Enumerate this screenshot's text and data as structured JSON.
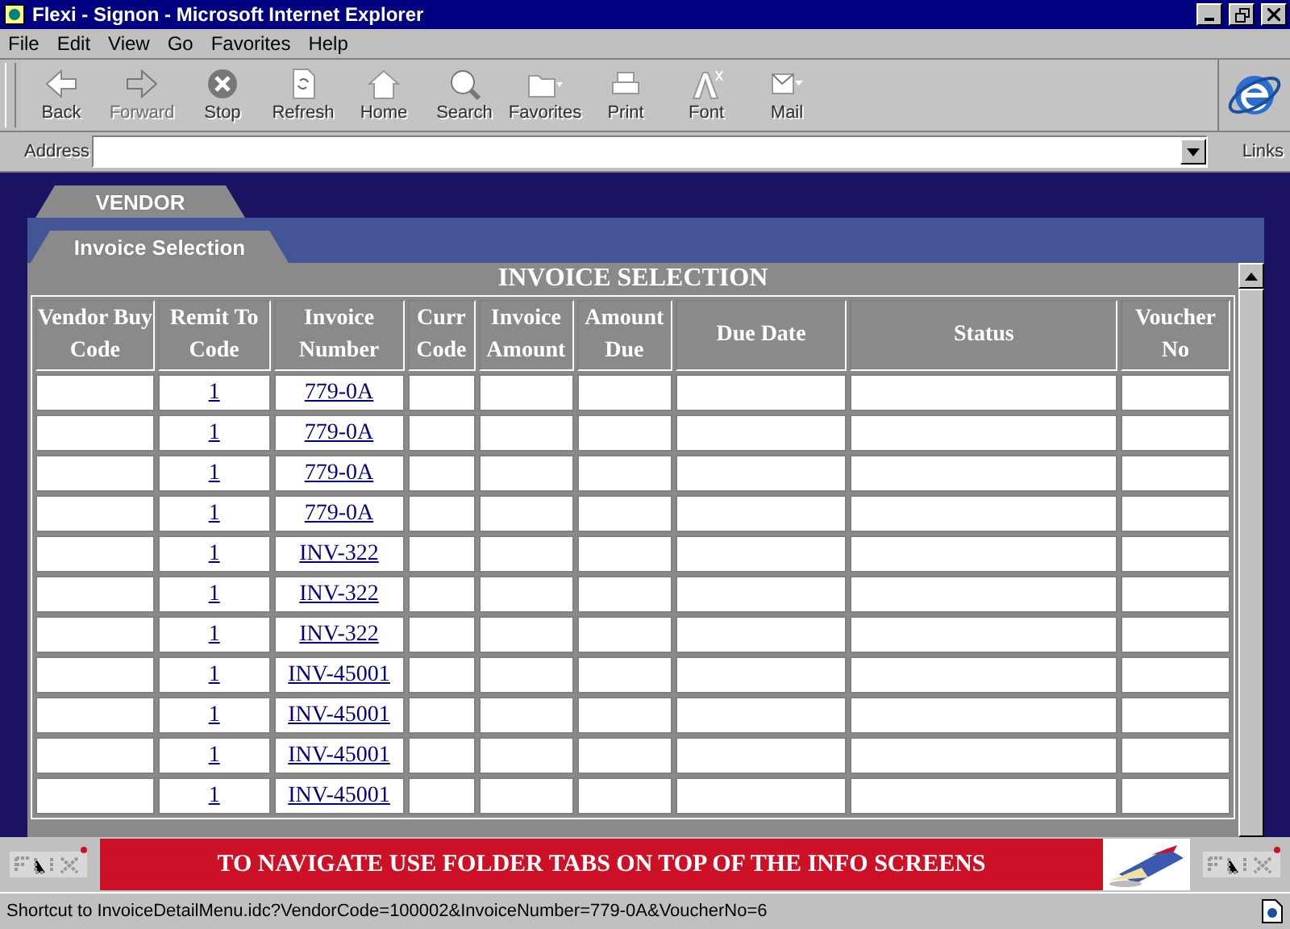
{
  "window": {
    "title": "Flexi - Signon - Microsoft Internet Explorer"
  },
  "menu": [
    "File",
    "Edit",
    "View",
    "Go",
    "Favorites",
    "Help"
  ],
  "toolbar": [
    {
      "label": "Back",
      "kind": "back",
      "disabled": false
    },
    {
      "label": "Forward",
      "kind": "forward",
      "disabled": true
    },
    {
      "label": "Stop",
      "kind": "stop",
      "disabled": false
    },
    {
      "label": "Refresh",
      "kind": "refresh",
      "disabled": false
    },
    {
      "label": "Home",
      "kind": "home",
      "disabled": false
    },
    {
      "label": "Search",
      "kind": "search",
      "disabled": false
    },
    {
      "label": "Favorites",
      "kind": "favorites",
      "disabled": false
    },
    {
      "label": "Print",
      "kind": "print",
      "disabled": false
    },
    {
      "label": "Font",
      "kind": "font",
      "disabled": false
    },
    {
      "label": "Mail",
      "kind": "mail",
      "disabled": false
    }
  ],
  "address": {
    "label": "Address"
  },
  "links": "Links",
  "tabs": [
    {
      "label": "VENDOR"
    },
    {
      "label": "Invoice Selection"
    }
  ],
  "table": {
    "title": "INVOICE SELECTION",
    "columns": [
      "Vendor Buy Code",
      "Remit To Code",
      "Invoice Number",
      "Curr Code",
      "Invoice Amount",
      "Amount Due",
      "Due Date",
      "Status",
      "Voucher No"
    ],
    "rows": [
      [
        "",
        "1",
        "779-0A",
        "",
        "",
        "",
        "",
        "",
        ""
      ],
      [
        "",
        "1",
        "779-0A",
        "",
        "",
        "",
        "",
        "",
        ""
      ],
      [
        "",
        "1",
        "779-0A",
        "",
        "",
        "",
        "",
        "",
        ""
      ],
      [
        "",
        "1",
        "779-0A",
        "",
        "",
        "",
        "",
        "",
        ""
      ],
      [
        "",
        "1",
        "INV-322",
        "",
        "",
        "",
        "",
        "",
        ""
      ],
      [
        "",
        "1",
        "INV-322",
        "",
        "",
        "",
        "",
        "",
        ""
      ],
      [
        "",
        "1",
        "INV-322",
        "",
        "",
        "",
        "",
        "",
        ""
      ],
      [
        "",
        "1",
        "INV-45001",
        "",
        "",
        "",
        "",
        "",
        ""
      ],
      [
        "",
        "1",
        "INV-45001",
        "",
        "",
        "",
        "",
        "",
        ""
      ],
      [
        "",
        "1",
        "INV-45001",
        "",
        "",
        "",
        "",
        "",
        ""
      ],
      [
        "",
        "1",
        "INV-45001",
        "",
        "",
        "",
        "",
        "",
        ""
      ]
    ]
  },
  "banner": "TO NAVIGATE USE FOLDER TABS ON TOP OF THE INFO SCREENS",
  "status_bar": "Shortcut to InvoiceDetailMenu.idc?VendorCode=100002&InvoiceNumber=779-0A&VoucherNo=6"
}
